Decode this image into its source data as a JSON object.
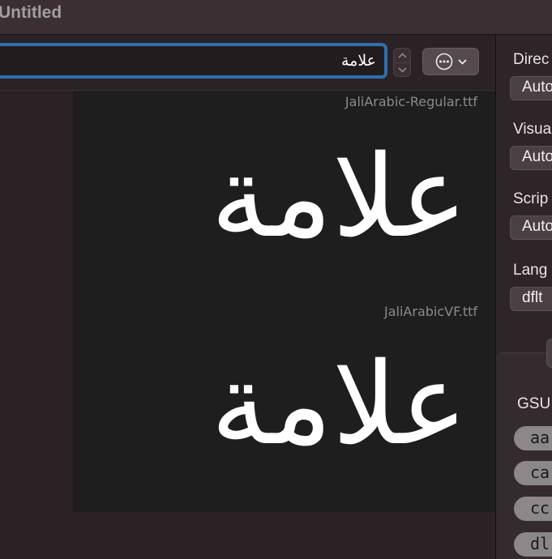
{
  "window": {
    "title": "Untitled"
  },
  "input": {
    "value": "علامة"
  },
  "icons": {
    "options": "ellipsis-circle-icon",
    "chevron": "chevron-down-icon",
    "stepper_up": "chevron-up-icon",
    "stepper_down": "chevron-down-icon"
  },
  "preview": {
    "fonts": [
      {
        "file": "JaliArabic-Regular.ttf",
        "sample": "علامة"
      },
      {
        "file": "JaliArabicVF.ttf",
        "sample": "علامة"
      }
    ]
  },
  "sidebar": {
    "direction": {
      "label": "Direc",
      "value": "Auto"
    },
    "visual": {
      "label": "Visua",
      "value": "Auto"
    },
    "script": {
      "label": "Scrip",
      "value": "Auto"
    },
    "language": {
      "label": "Lang",
      "value": "dflt"
    },
    "gsub_label": "GSU",
    "features": [
      "aa",
      "ca",
      "cc",
      "dl"
    ]
  },
  "colors": {
    "accent": "#2f6fb0",
    "preview_bg": "#1e1e1e"
  }
}
